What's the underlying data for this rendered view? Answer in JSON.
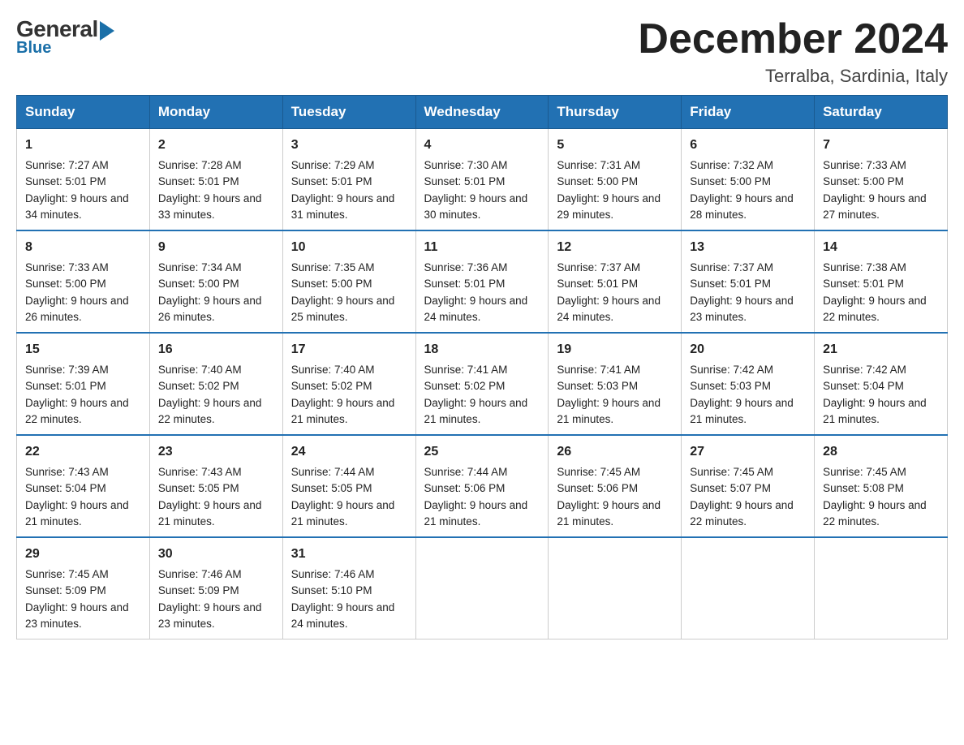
{
  "logo": {
    "general": "General",
    "blue": "Blue"
  },
  "title": "December 2024",
  "location": "Terralba, Sardinia, Italy",
  "headers": [
    "Sunday",
    "Monday",
    "Tuesday",
    "Wednesday",
    "Thursday",
    "Friday",
    "Saturday"
  ],
  "weeks": [
    [
      {
        "day": "1",
        "sunrise": "7:27 AM",
        "sunset": "5:01 PM",
        "daylight": "9 hours and 34 minutes."
      },
      {
        "day": "2",
        "sunrise": "7:28 AM",
        "sunset": "5:01 PM",
        "daylight": "9 hours and 33 minutes."
      },
      {
        "day": "3",
        "sunrise": "7:29 AM",
        "sunset": "5:01 PM",
        "daylight": "9 hours and 31 minutes."
      },
      {
        "day": "4",
        "sunrise": "7:30 AM",
        "sunset": "5:01 PM",
        "daylight": "9 hours and 30 minutes."
      },
      {
        "day": "5",
        "sunrise": "7:31 AM",
        "sunset": "5:00 PM",
        "daylight": "9 hours and 29 minutes."
      },
      {
        "day": "6",
        "sunrise": "7:32 AM",
        "sunset": "5:00 PM",
        "daylight": "9 hours and 28 minutes."
      },
      {
        "day": "7",
        "sunrise": "7:33 AM",
        "sunset": "5:00 PM",
        "daylight": "9 hours and 27 minutes."
      }
    ],
    [
      {
        "day": "8",
        "sunrise": "7:33 AM",
        "sunset": "5:00 PM",
        "daylight": "9 hours and 26 minutes."
      },
      {
        "day": "9",
        "sunrise": "7:34 AM",
        "sunset": "5:00 PM",
        "daylight": "9 hours and 26 minutes."
      },
      {
        "day": "10",
        "sunrise": "7:35 AM",
        "sunset": "5:00 PM",
        "daylight": "9 hours and 25 minutes."
      },
      {
        "day": "11",
        "sunrise": "7:36 AM",
        "sunset": "5:01 PM",
        "daylight": "9 hours and 24 minutes."
      },
      {
        "day": "12",
        "sunrise": "7:37 AM",
        "sunset": "5:01 PM",
        "daylight": "9 hours and 24 minutes."
      },
      {
        "day": "13",
        "sunrise": "7:37 AM",
        "sunset": "5:01 PM",
        "daylight": "9 hours and 23 minutes."
      },
      {
        "day": "14",
        "sunrise": "7:38 AM",
        "sunset": "5:01 PM",
        "daylight": "9 hours and 22 minutes."
      }
    ],
    [
      {
        "day": "15",
        "sunrise": "7:39 AM",
        "sunset": "5:01 PM",
        "daylight": "9 hours and 22 minutes."
      },
      {
        "day": "16",
        "sunrise": "7:40 AM",
        "sunset": "5:02 PM",
        "daylight": "9 hours and 22 minutes."
      },
      {
        "day": "17",
        "sunrise": "7:40 AM",
        "sunset": "5:02 PM",
        "daylight": "9 hours and 21 minutes."
      },
      {
        "day": "18",
        "sunrise": "7:41 AM",
        "sunset": "5:02 PM",
        "daylight": "9 hours and 21 minutes."
      },
      {
        "day": "19",
        "sunrise": "7:41 AM",
        "sunset": "5:03 PM",
        "daylight": "9 hours and 21 minutes."
      },
      {
        "day": "20",
        "sunrise": "7:42 AM",
        "sunset": "5:03 PM",
        "daylight": "9 hours and 21 minutes."
      },
      {
        "day": "21",
        "sunrise": "7:42 AM",
        "sunset": "5:04 PM",
        "daylight": "9 hours and 21 minutes."
      }
    ],
    [
      {
        "day": "22",
        "sunrise": "7:43 AM",
        "sunset": "5:04 PM",
        "daylight": "9 hours and 21 minutes."
      },
      {
        "day": "23",
        "sunrise": "7:43 AM",
        "sunset": "5:05 PM",
        "daylight": "9 hours and 21 minutes."
      },
      {
        "day": "24",
        "sunrise": "7:44 AM",
        "sunset": "5:05 PM",
        "daylight": "9 hours and 21 minutes."
      },
      {
        "day": "25",
        "sunrise": "7:44 AM",
        "sunset": "5:06 PM",
        "daylight": "9 hours and 21 minutes."
      },
      {
        "day": "26",
        "sunrise": "7:45 AM",
        "sunset": "5:06 PM",
        "daylight": "9 hours and 21 minutes."
      },
      {
        "day": "27",
        "sunrise": "7:45 AM",
        "sunset": "5:07 PM",
        "daylight": "9 hours and 22 minutes."
      },
      {
        "day": "28",
        "sunrise": "7:45 AM",
        "sunset": "5:08 PM",
        "daylight": "9 hours and 22 minutes."
      }
    ],
    [
      {
        "day": "29",
        "sunrise": "7:45 AM",
        "sunset": "5:09 PM",
        "daylight": "9 hours and 23 minutes."
      },
      {
        "day": "30",
        "sunrise": "7:46 AM",
        "sunset": "5:09 PM",
        "daylight": "9 hours and 23 minutes."
      },
      {
        "day": "31",
        "sunrise": "7:46 AM",
        "sunset": "5:10 PM",
        "daylight": "9 hours and 24 minutes."
      },
      null,
      null,
      null,
      null
    ]
  ],
  "labels": {
    "sunrise": "Sunrise: ",
    "sunset": "Sunset: ",
    "daylight": "Daylight: "
  }
}
